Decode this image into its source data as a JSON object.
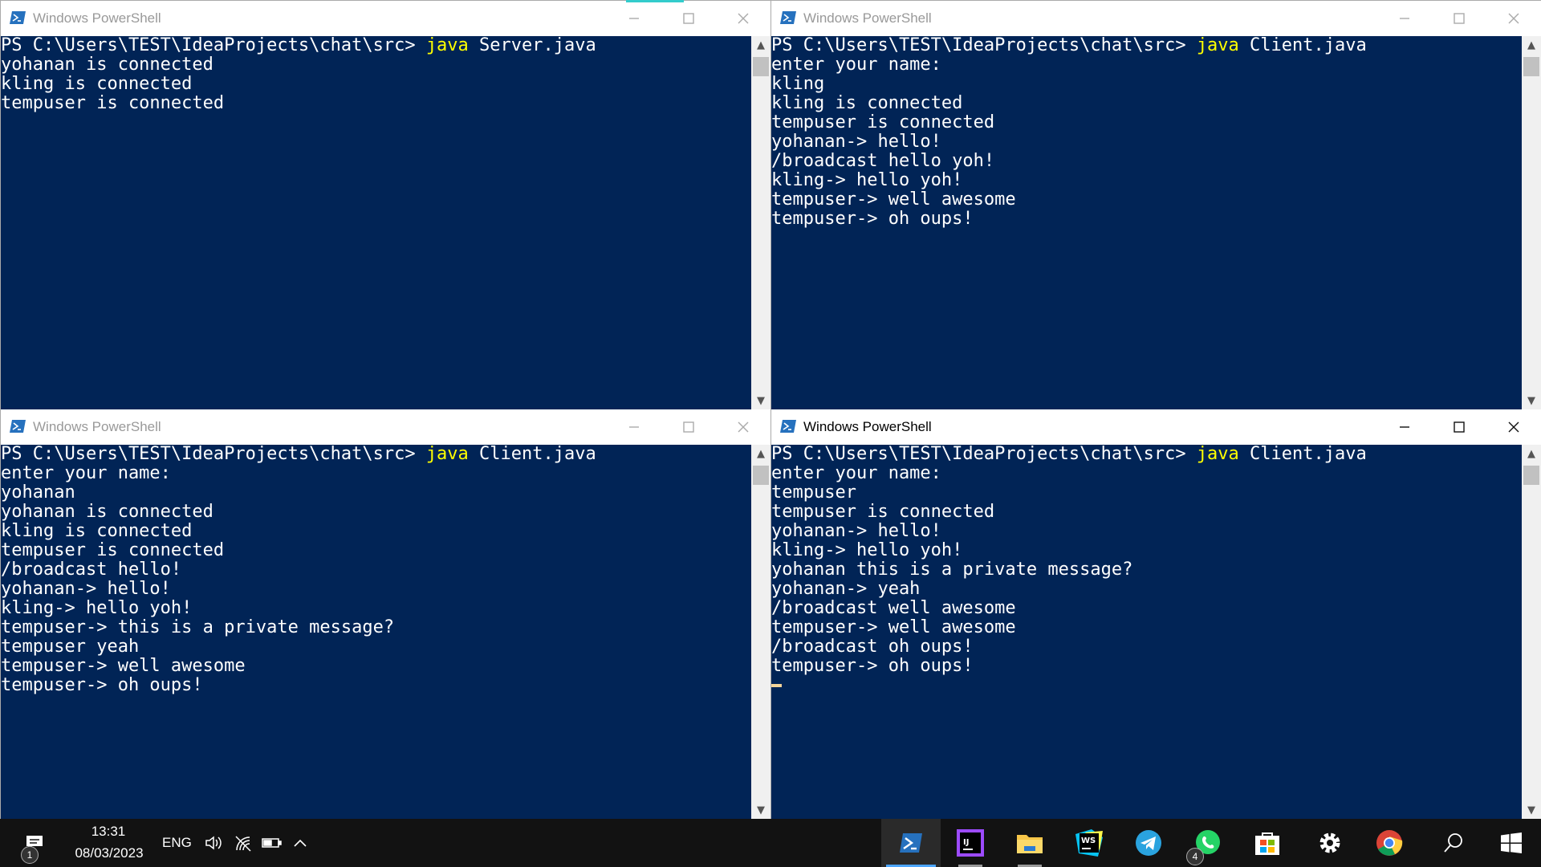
{
  "windows": [
    {
      "title": "Windows PowerShell",
      "lines": [
        {
          "pre": "PS C:\\Users\\TEST\\IdeaProjects\\chat\\src> ",
          "kw": "java",
          "post": " Server.java"
        },
        {
          "pre": "yohanan is connected"
        },
        {
          "pre": "kling is connected"
        },
        {
          "pre": "tempuser is connected"
        }
      ]
    },
    {
      "title": "Windows PowerShell",
      "lines": [
        {
          "pre": "PS C:\\Users\\TEST\\IdeaProjects\\chat\\src> ",
          "kw": "java",
          "post": " Client.java"
        },
        {
          "pre": "enter your name:"
        },
        {
          "pre": "kling"
        },
        {
          "pre": "kling is connected"
        },
        {
          "pre": "tempuser is connected"
        },
        {
          "pre": "yohanan-> hello!"
        },
        {
          "pre": "/broadcast hello yoh!"
        },
        {
          "pre": "kling-> hello yoh!"
        },
        {
          "pre": "tempuser-> well awesome"
        },
        {
          "pre": "tempuser-> oh oups!"
        }
      ]
    },
    {
      "title": "Windows PowerShell",
      "lines": [
        {
          "pre": "PS C:\\Users\\TEST\\IdeaProjects\\chat\\src> ",
          "kw": "java",
          "post": " Client.java"
        },
        {
          "pre": "enter your name:"
        },
        {
          "pre": "yohanan"
        },
        {
          "pre": "yohanan is connected"
        },
        {
          "pre": "kling is connected"
        },
        {
          "pre": "tempuser is connected"
        },
        {
          "pre": "/broadcast hello!"
        },
        {
          "pre": "yohanan-> hello!"
        },
        {
          "pre": "kling-> hello yoh!"
        },
        {
          "pre": "tempuser-> this is a private message?"
        },
        {
          "pre": "tempuser yeah"
        },
        {
          "pre": "tempuser-> well awesome"
        },
        {
          "pre": "tempuser-> oh oups!"
        }
      ]
    },
    {
      "title": "Windows PowerShell",
      "active": true,
      "lines": [
        {
          "pre": "PS C:\\Users\\TEST\\IdeaProjects\\chat\\src> ",
          "kw": "java",
          "post": " Client.java"
        },
        {
          "pre": "enter your name:"
        },
        {
          "pre": "tempuser"
        },
        {
          "pre": "tempuser is connected"
        },
        {
          "pre": "yohanan-> hello!"
        },
        {
          "pre": "kling-> hello yoh!"
        },
        {
          "pre": "yohanan this is a private message?"
        },
        {
          "pre": "yohanan-> yeah"
        },
        {
          "pre": "/broadcast well awesome"
        },
        {
          "pre": "tempuser-> well awesome"
        },
        {
          "pre": "/broadcast oh oups!"
        },
        {
          "pre": "tempuser-> oh oups!"
        }
      ]
    }
  ],
  "taskbar": {
    "time": "13:31",
    "date": "08/03/2023",
    "language": "ENG",
    "notification_badge": "1",
    "whatsapp_badge": "4",
    "apps": [
      "powershell-icon",
      "intellij-icon",
      "file-explorer-icon",
      "webstorm-icon",
      "telegram-icon",
      "whatsapp-icon",
      "microsoft-store-icon",
      "settings-icon",
      "chrome-icon",
      "search-icon",
      "start-icon"
    ]
  },
  "colors": {
    "console_bg": "#012456",
    "console_fg": "#ffffff",
    "keyword": "#ffff00",
    "taskbar_bg": "#121212"
  }
}
